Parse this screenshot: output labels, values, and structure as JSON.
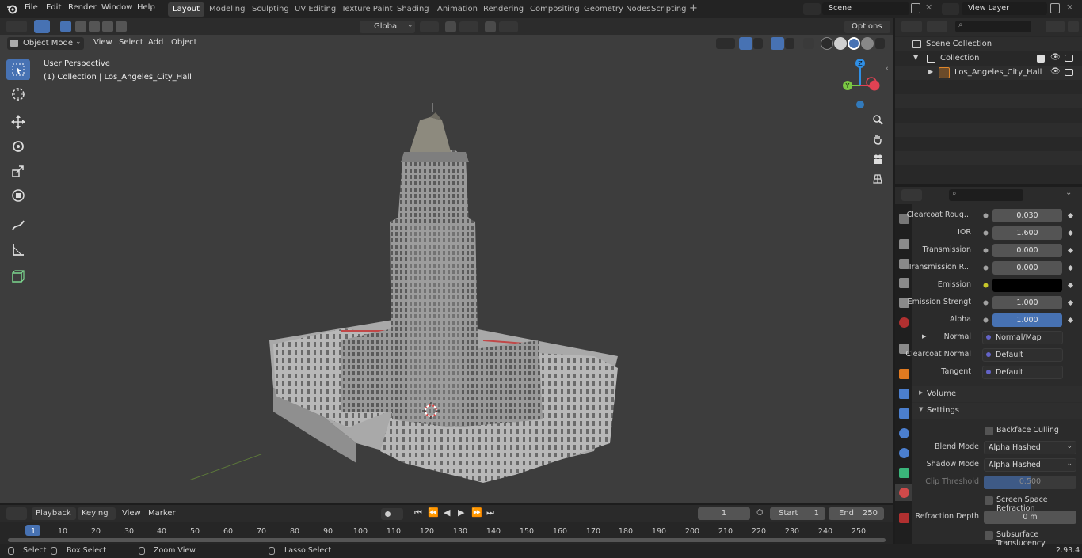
{
  "menu": {
    "file": "File",
    "edit": "Edit",
    "render": "Render",
    "window": "Window",
    "help": "Help"
  },
  "workspaces": [
    "Layout",
    "Modeling",
    "Sculpting",
    "UV Editing",
    "Texture Paint",
    "Shading",
    "Animation",
    "Rendering",
    "Compositing",
    "Geometry Nodes",
    "Scripting"
  ],
  "active_workspace": "Layout",
  "scene": {
    "name": "Scene",
    "view_layer": "View Layer"
  },
  "toolbar": {
    "transform_orientation": "Global",
    "options": "Options"
  },
  "vp_header": {
    "mode": "Object Mode",
    "view": "View",
    "select": "Select",
    "add": "Add",
    "object": "Object"
  },
  "viewport": {
    "perspective": "User Perspective",
    "collection_info": "(1) Collection | Los_Angeles_City_Hall"
  },
  "gizmo": {
    "z": "Z",
    "y": "Y"
  },
  "outliner": {
    "scene_collection": "Scene Collection",
    "collection": "Collection",
    "object": "Los_Angeles_City_Hall"
  },
  "properties": {
    "clearcoat_roughness": {
      "label": "Clearcoat Roug...",
      "value": "0.030"
    },
    "ior": {
      "label": "IOR",
      "value": "1.600"
    },
    "transmission": {
      "label": "Transmission",
      "value": "0.000"
    },
    "transmission_roughness": {
      "label": "Transmission R...",
      "value": "0.000"
    },
    "emission": {
      "label": "Emission",
      "color": "#000000"
    },
    "emission_strength": {
      "label": "Emission Strengt",
      "value": "1.000"
    },
    "alpha": {
      "label": "Alpha",
      "value": "1.000"
    },
    "normal": {
      "label": "Normal",
      "value": "Normal/Map"
    },
    "clearcoat_normal": {
      "label": "Clearcoat Normal",
      "value": "Default"
    },
    "tangent": {
      "label": "Tangent",
      "value": "Default"
    },
    "volume_panel": "Volume",
    "settings_panel": "Settings",
    "backface_culling": "Backface Culling",
    "blend_mode": {
      "label": "Blend Mode",
      "value": "Alpha Hashed"
    },
    "shadow_mode": {
      "label": "Shadow Mode",
      "value": "Alpha Hashed"
    },
    "clip_threshold": {
      "label": "Clip Threshold",
      "value": "0.500"
    },
    "screen_space_refraction": "Screen Space Refraction",
    "refraction_depth": {
      "label": "Refraction Depth",
      "value": "0 m"
    },
    "subsurface_translucency": "Subsurface Translucency"
  },
  "timeline": {
    "playback": "Playback",
    "keying": "Keying",
    "view": "View",
    "marker": "Marker",
    "current_frame": "1",
    "start_label": "Start",
    "start": "1",
    "end_label": "End",
    "end": "250",
    "ticks": [
      "1",
      "10",
      "20",
      "30",
      "40",
      "50",
      "60",
      "70",
      "80",
      "90",
      "100",
      "110",
      "120",
      "130",
      "140",
      "150",
      "160",
      "170",
      "180",
      "190",
      "200",
      "210",
      "220",
      "230",
      "240",
      "250"
    ]
  },
  "status": {
    "select": "Select",
    "box_select": "Box Select",
    "zoom_view": "Zoom View",
    "lasso_select": "Lasso Select",
    "version": "2.93.4"
  },
  "colors": {
    "accent": "#4772b3",
    "viewport_bg": "#3d3d3d",
    "gizmo_x": "#e04253",
    "gizmo_y": "#7ac943",
    "gizmo_z": "#2f8fe6"
  }
}
